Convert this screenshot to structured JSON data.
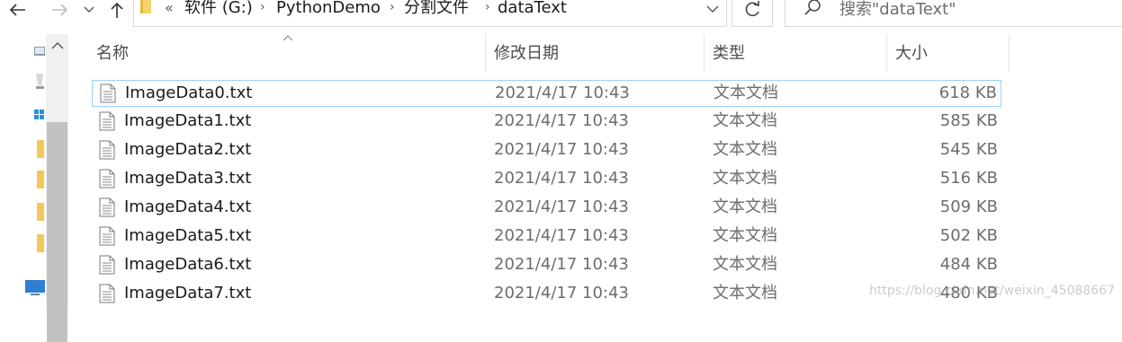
{
  "toolbar": {
    "back_icon": "arrow-left-icon",
    "forward_icon": "arrow-right-icon",
    "recent_icon": "chevron-down-icon",
    "up_icon": "arrow-up-icon"
  },
  "address_bar": {
    "overflow": "«",
    "breadcrumbs": [
      "软件 (G:)",
      "PythonDemo",
      "分割文件",
      "dataText"
    ],
    "separator": "›"
  },
  "search": {
    "placeholder": "搜索\"dataText\""
  },
  "columns": {
    "name": "名称",
    "date": "修改日期",
    "type": "类型",
    "size": "大小"
  },
  "files": [
    {
      "name": "ImageData0.txt",
      "date": "2021/4/17 10:43",
      "type": "文本文档",
      "size": "618 KB"
    },
    {
      "name": "ImageData1.txt",
      "date": "2021/4/17 10:43",
      "type": "文本文档",
      "size": "585 KB"
    },
    {
      "name": "ImageData2.txt",
      "date": "2021/4/17 10:43",
      "type": "文本文档",
      "size": "545 KB"
    },
    {
      "name": "ImageData3.txt",
      "date": "2021/4/17 10:43",
      "type": "文本文档",
      "size": "516 KB"
    },
    {
      "name": "ImageData4.txt",
      "date": "2021/4/17 10:43",
      "type": "文本文档",
      "size": "509 KB"
    },
    {
      "name": "ImageData5.txt",
      "date": "2021/4/17 10:43",
      "type": "文本文档",
      "size": "502 KB"
    },
    {
      "name": "ImageData6.txt",
      "date": "2021/4/17 10:43",
      "type": "文本文档",
      "size": "484 KB"
    },
    {
      "name": "ImageData7.txt",
      "date": "2021/4/17 10:43",
      "type": "文本文档",
      "size": "480 KB"
    }
  ],
  "selected_index": 0,
  "watermark": "https://blog.csdn.net/weixin_45088667",
  "colors": {
    "selection_border": "#99d1ff",
    "header_text": "#4c4c4c",
    "secondary_text": "#6d6d6d"
  }
}
